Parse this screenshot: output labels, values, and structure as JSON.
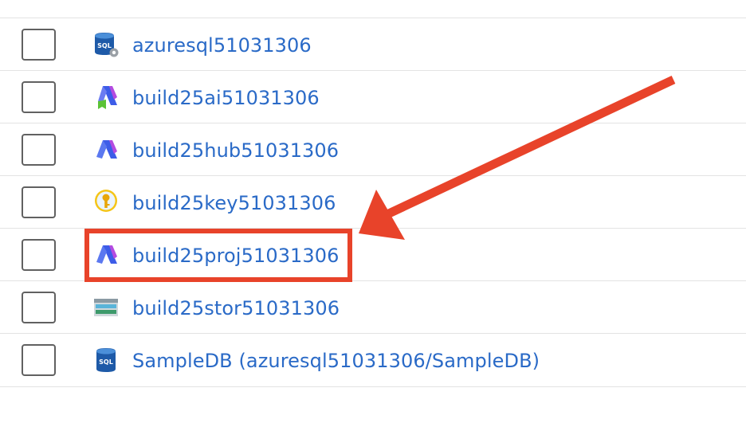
{
  "resource_list": {
    "items": [
      {
        "name": "azuresql51031306",
        "icon": "sql-server-icon"
      },
      {
        "name": "build25ai51031306",
        "icon": "ai-foundry-icon"
      },
      {
        "name": "build25hub51031306",
        "icon": "ai-foundry-hub-icon"
      },
      {
        "name": "build25key51031306",
        "icon": "key-vault-icon"
      },
      {
        "name": "build25proj51031306",
        "icon": "ai-foundry-project-icon"
      },
      {
        "name": "build25stor51031306",
        "icon": "storage-account-icon"
      },
      {
        "name": "SampleDB (azuresql51031306/SampleDB)",
        "icon": "sql-database-icon"
      }
    ]
  },
  "annotation": {
    "highlighted_item": "build25proj51031306",
    "highlight_color": "#e8432a"
  },
  "colors": {
    "link": "#2a6ac7",
    "checkbox_border": "#616161",
    "divider": "#e3e3e3"
  }
}
